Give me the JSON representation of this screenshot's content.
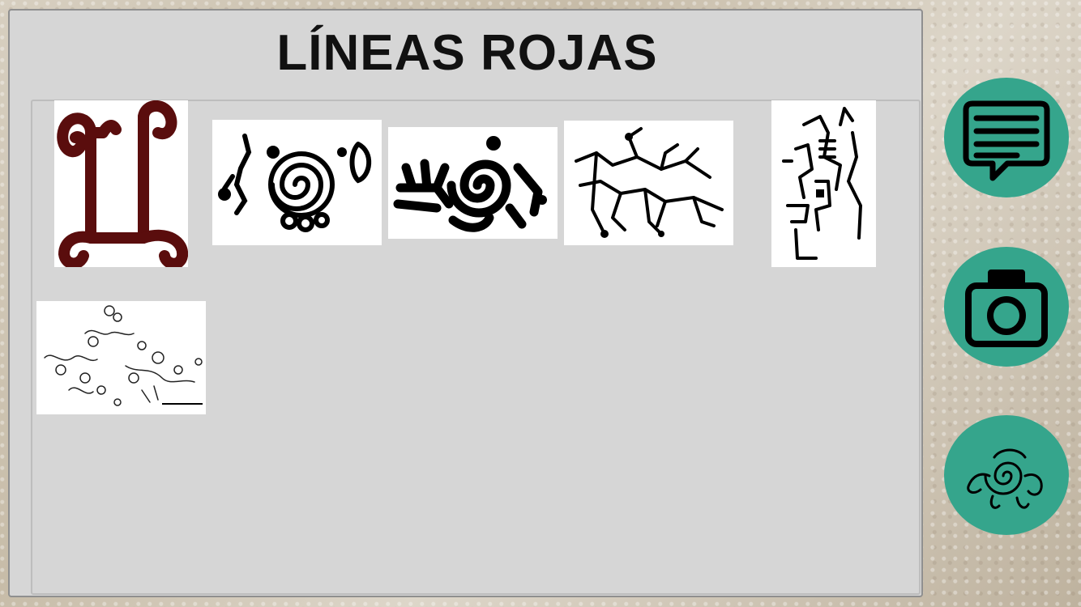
{
  "screen": {
    "title": "LÍNEAS ROJAS"
  },
  "gallery": {
    "items": [
      {
        "icon": "red-scroll-petroglyph-image"
      },
      {
        "icon": "spiral-figures-petroglyph-image"
      },
      {
        "icon": "spiral-branch-petroglyph-image"
      },
      {
        "icon": "branching-lines-petroglyph-image"
      },
      {
        "icon": "maze-petroglyph-image"
      },
      {
        "icon": "scattered-figures-petroglyph-image"
      }
    ]
  },
  "actions": {
    "items": [
      {
        "icon": "chat-bubble-icon"
      },
      {
        "icon": "camera-icon"
      },
      {
        "icon": "spiral-glyph-icon"
      }
    ]
  },
  "colors": {
    "accent": "#35a58c",
    "panel": "#d6d6d6",
    "petroglyph_red": "#5a0d0d"
  }
}
